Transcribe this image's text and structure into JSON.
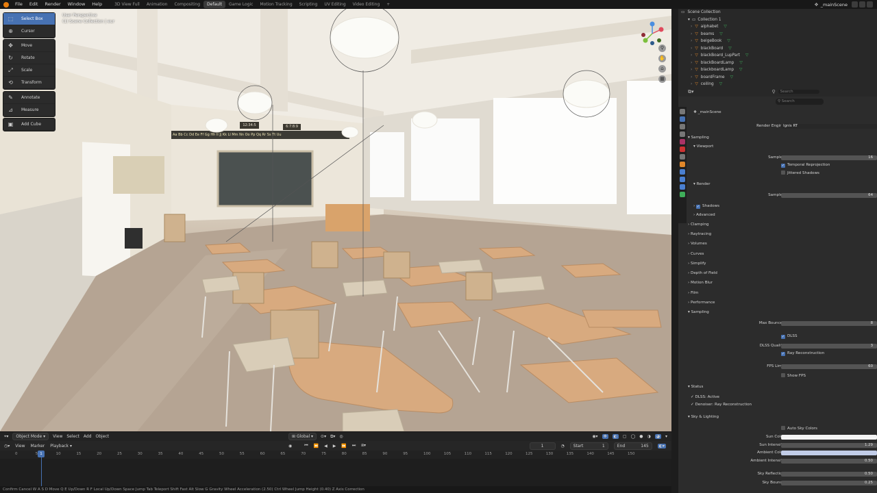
{
  "topbar": {
    "menus": [
      "File",
      "Edit",
      "Render",
      "Window",
      "Help"
    ],
    "workspaces": [
      "3D View Full",
      "Animation",
      "Compositing",
      "Default",
      "Game Logic",
      "Motion Tracking",
      "Scripting",
      "UV Editing",
      "Video Editing"
    ],
    "active_workspace": "Default",
    "add_tab": "+",
    "scene_name": "_mainScene"
  },
  "viewport": {
    "overlay_line1": "User Perspective",
    "overlay_line2": "(1) Scene Collection | eur",
    "tools": [
      {
        "label": "Select Box",
        "icon": "select-box-icon",
        "glyph": "⬚"
      },
      {
        "label": "Cursor",
        "icon": "cursor-icon",
        "glyph": "⊕"
      },
      {
        "label": "Move",
        "icon": "move-icon",
        "glyph": "✥"
      },
      {
        "label": "Rotate",
        "icon": "rotate-icon",
        "glyph": "↻"
      },
      {
        "label": "Scale",
        "icon": "scale-icon",
        "glyph": "⤢"
      },
      {
        "label": "Transform",
        "icon": "transform-icon",
        "glyph": "⟲"
      },
      {
        "label": "Annotate",
        "icon": "annotate-icon",
        "glyph": "✎"
      },
      {
        "label": "Measure",
        "icon": "measure-icon",
        "glyph": "📐"
      },
      {
        "label": "Add Cube",
        "icon": "add-cube-icon",
        "glyph": "▣"
      }
    ],
    "clock_left": "12:34:5",
    "clock_right": "6:7:8:9",
    "alphabet_strip": "Aa Bb Cc Dd Ee Ff Gg Hh Ii Jj Kk Ll Mm Nn Oo Pp Qq Rr Ss Tt Uu"
  },
  "viewport_header": {
    "mode": "Object Mode",
    "menus": [
      "View",
      "Select",
      "Add",
      "Object"
    ],
    "orientation": "Global"
  },
  "timeline": {
    "menus": [
      "View",
      "Marker"
    ],
    "playback": "Playback",
    "current_frame": "1",
    "start_label": "Start",
    "start": "1",
    "end_label": "End",
    "end": "145",
    "ruler": [
      "0",
      "5",
      "10",
      "15",
      "20",
      "25",
      "30",
      "35",
      "40",
      "45",
      "50",
      "55",
      "60",
      "65",
      "70",
      "75",
      "80",
      "85",
      "90",
      "95",
      "100",
      "105",
      "110",
      "115",
      "120",
      "125",
      "130",
      "135",
      "140",
      "145",
      "150"
    ],
    "playhead": "1"
  },
  "status_bar": "Confirm  Cancel  W A S D Move  Q E Up/Down  R F Local Up/Down  Space Jump  Tab Teleport  Shift Fast  Alt Slow  G Gravity  Wheel Acceleration (2.50)  Ctrl Wheel Jump Height (0.40)  Z Axis Correction",
  "outliner": {
    "root": "Scene Collection",
    "collection": "Collection 1",
    "items": [
      "alphabet",
      "beams",
      "beigeBook",
      "blackBoard",
      "blackBoard_LupPart",
      "blackBoardLamp",
      "blackboardLamp",
      "boardFrame",
      "ceiling"
    ],
    "search_placeholder": "Search"
  },
  "properties": {
    "search_placeholder": "Search",
    "scene": "_mainScene",
    "render_engine_label": "Render Engine",
    "render_engine": "Ignis RT",
    "sections": {
      "sampling": "Sampling",
      "viewport": "Viewport",
      "render": "Render",
      "shadows": "Shadows",
      "advanced": "Advanced",
      "clamping": "Clamping",
      "raytracing": "Raytracing",
      "volumes": "Volumes",
      "curves": "Curves",
      "simplify": "Simplify",
      "dof": "Depth of Field",
      "motion_blur": "Motion Blur",
      "film": "Film",
      "performance": "Performance",
      "sampling2": "Sampling",
      "status": "Status",
      "sky": "Sky & Lighting"
    },
    "samples_label": "Samples",
    "viewport_samples": "16",
    "temporal_reprojection": "Temporal Reprojection",
    "jittered_shadows": "Jittered Shadows",
    "render_samples": "64",
    "max_bounces_label": "Max Bounces",
    "max_bounces": "8",
    "dlss": "DLSS",
    "dlss_quality_label": "DLSS Quality",
    "dlss_quality": "3",
    "ray_reconstruction": "Ray Reconstruction",
    "fps_limit_label": "FPS Limit",
    "fps_limit": "60",
    "show_fps": "Show FPS",
    "status_dlss": "DLSS: Active",
    "status_denoiser": "Denoiser: Ray Reconstruction",
    "auto_sky": "Auto Sky Colors",
    "sun_color_label": "Sun Color",
    "sun_intensity_label": "Sun Intensity",
    "sun_intensity": "1.29",
    "ambient_color_label": "Ambient Color",
    "ambient_intensity_label": "Ambient Intensity",
    "ambient_intensity": "0.50",
    "sky_reflection_label": "Sky Reflection",
    "sky_reflection": "0.50",
    "sky_bounce_label": "Sky Bounce",
    "sky_bounce": "0.25"
  },
  "colors": {
    "accent": "#4772b3",
    "sun_color": "#f4f4f4",
    "ambient_color": "#c2cde8"
  }
}
